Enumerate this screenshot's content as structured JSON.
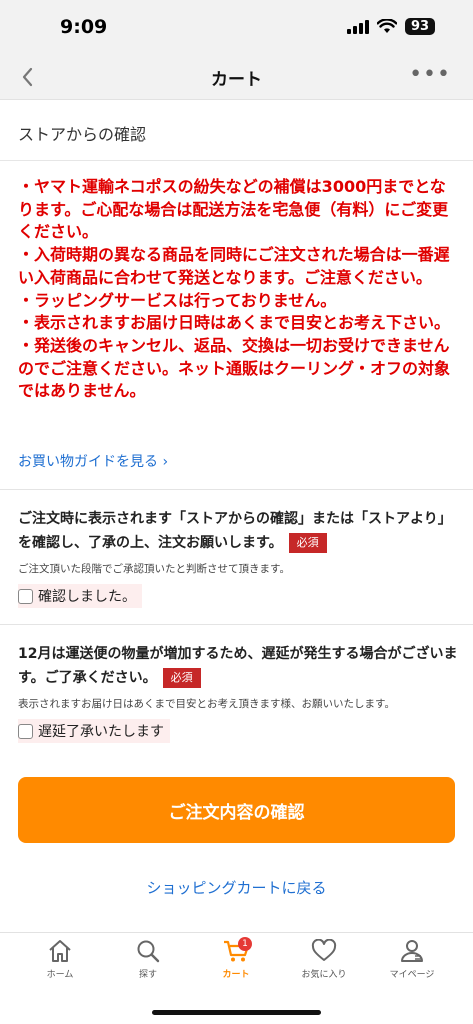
{
  "status_bar": {
    "time": "9:09",
    "battery": "93"
  },
  "header": {
    "title": "カート"
  },
  "section": {
    "title": "ストアからの確認"
  },
  "notice_lines": [
    "・ヤマト運輸ネコポスの紛失などの補償は3000円までとなります。ご心配な場合は配送方法を宅急便（有料）にご変更ください。",
    "・入荷時期の異なる商品を同時にご注文された場合は一番遅い入荷商品に合わせて発送となります。ご注意ください。",
    "・ラッピングサービスは行っておりません。",
    "・表示されますお届け日時はあくまで目安とお考え下さい。",
    "・発送後のキャンセル、返品、交換は一切お受けできませんのでご注意ください。ネット通販はクーリング・オフの対象ではありません。"
  ],
  "guide_link": "お買い物ガイドを見る ›",
  "confirm1": {
    "text": "ご注文時に表示されます「ストアからの確認」または「ストアより」を確認し、了承の上、注文お願いします。",
    "badge": "必須",
    "sub": "ご注文頂いた段階でご承認頂いたと判断させて頂きます。",
    "checkbox_label": "確認しました。"
  },
  "confirm2": {
    "text": "12月は運送便の物量が増加するため、遅延が発生する場合がございます。ご了承ください。",
    "badge": "必須",
    "sub": "表示されますお届け日はあくまで目安とお考え頂きます様、お願いいたします。",
    "checkbox_label": "遅延了承いたします"
  },
  "primary_button": "ご注文内容の確認",
  "back_link": "ショッピングカートに戻る",
  "tab_bar": {
    "cart_badge": "1",
    "items": [
      {
        "label": "ホーム",
        "icon": "home-icon"
      },
      {
        "label": "探す",
        "icon": "search-icon"
      },
      {
        "label": "カート",
        "icon": "cart-icon"
      },
      {
        "label": "お気に入り",
        "icon": "heart-icon"
      },
      {
        "label": "マイページ",
        "icon": "user-icon"
      }
    ]
  },
  "colors": {
    "accent": "#ff8a00",
    "notice": "#e00000",
    "link": "#1f6fd1",
    "badge": "#c62828"
  }
}
